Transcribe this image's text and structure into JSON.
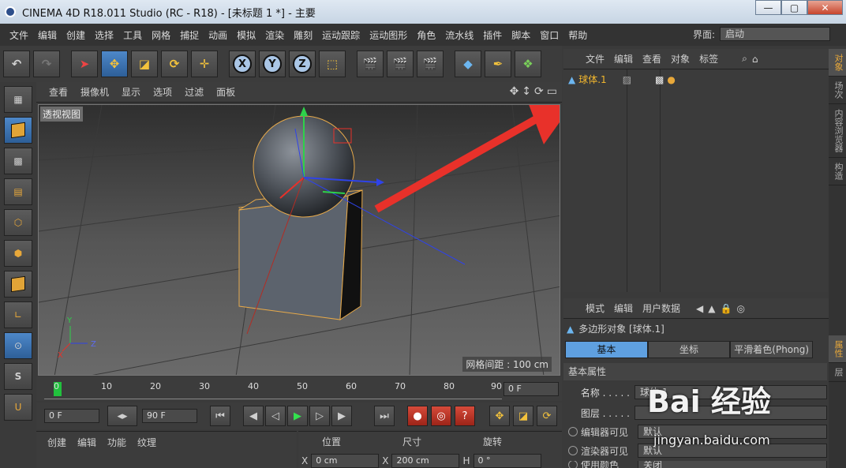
{
  "window": {
    "title": "CINEMA 4D R18.011 Studio (RC - R18) - [未标题 1 *] - 主要",
    "min": "—",
    "max": "▢",
    "close": "✕"
  },
  "menu": [
    "文件",
    "编辑",
    "创建",
    "选择",
    "工具",
    "网格",
    "捕捉",
    "动画",
    "模拟",
    "渲染",
    "雕刻",
    "运动跟踪",
    "运动图形",
    "角色",
    "流水线",
    "插件",
    "脚本",
    "窗口",
    "帮助"
  ],
  "layout": {
    "label": "界面:",
    "value": "启动"
  },
  "toolbar": {
    "x": "X",
    "y": "Y",
    "z": "Z"
  },
  "viewport": {
    "menu": [
      "查看",
      "摄像机",
      "显示",
      "选项",
      "过滤",
      "面板"
    ],
    "label": "透视视图",
    "grid_distance": "网格间距 : 100 cm",
    "axis_y": "Y",
    "axis_z": "Z",
    "axis_x": "X"
  },
  "timeline": {
    "ticks": [
      "0",
      "10",
      "20",
      "30",
      "40",
      "50",
      "60",
      "70",
      "80",
      "90"
    ],
    "current_frame": "0 F",
    "start_frame": "0 F",
    "end_frame": "90 F"
  },
  "bottom_menu": [
    "创建",
    "编辑",
    "功能",
    "纹理"
  ],
  "coords": {
    "headers": [
      "位置",
      "尺寸",
      "旋转"
    ],
    "x_label": "X",
    "x_pos": "0 cm",
    "x_size_label": "X",
    "x_size": "200 cm",
    "h_label": "H",
    "h_rot": "0 °"
  },
  "object_manager": {
    "menu": [
      "文件",
      "编辑",
      "查看",
      "对象",
      "标签"
    ],
    "object_name": "球体.1"
  },
  "right_tabs": [
    "对象",
    "场次",
    "内容浏览器",
    "构造"
  ],
  "attribute_tabs_side": [
    "属性",
    "层"
  ],
  "attributes": {
    "menu": [
      "模式",
      "编辑",
      "用户数据"
    ],
    "title": "多边形对象 [球体.1]",
    "tabs": [
      "基本",
      "坐标",
      "平滑着色(Phong)"
    ],
    "section": "基本属性",
    "name_label": "名称 . . . . .",
    "name_value": "球体.1",
    "layer_label": "图层 . . . . .",
    "editor_visible_label": "编辑器可见",
    "editor_visible_value": "默认",
    "render_visible_label": "渲染器可见",
    "render_visible_value": "默认",
    "use_color_label": "使用颜色",
    "use_color_value": "关闭"
  },
  "watermark": {
    "brand": "Bai 经验",
    "url": "jingyan.baidu.com"
  },
  "colors": {
    "accent_blue": "#4e88c9",
    "selection_orange": "#e8a83a",
    "arrow_red": "#e8312a"
  }
}
